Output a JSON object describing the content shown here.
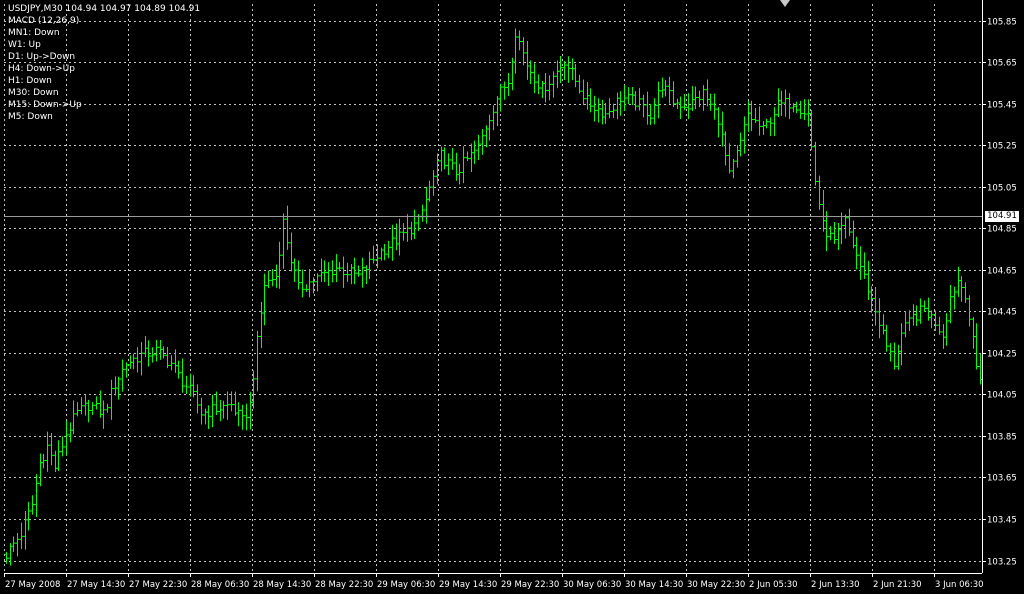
{
  "header": {
    "symbol_line": "USDJPY,M30  104.94 104.97 104.89 104.91",
    "indicator": "MACD (12,26,9)",
    "trend_lines": [
      "MN1: Down",
      "W1: Up",
      "D1: Up->Down",
      "H4: Down->Up",
      "H1: Down",
      "M30: Down",
      "M15: Down->Up",
      "M5: Down"
    ]
  },
  "colors": {
    "background": "#000000",
    "bars": "#00ff00",
    "grid": "#c0c0c0",
    "text": "#ffffff"
  },
  "current_price": "104.91",
  "chart_data": {
    "type": "ohlc_bar",
    "symbol": "USDJPY",
    "timeframe": "M30",
    "grid": true,
    "ylim": [
      103.19,
      105.93
    ],
    "y_ticks": [
      "105.85",
      "105.65",
      "105.45",
      "105.25",
      "105.05",
      "104.85",
      "104.65",
      "104.45",
      "104.25",
      "104.05",
      "103.85",
      "103.65",
      "103.45",
      "103.25"
    ],
    "x_ticks": [
      "27 May 2008",
      "27 May 14:30",
      "27 May 22:30",
      "28 May 06:30",
      "28 May 14:30",
      "28 May 22:30",
      "29 May 06:30",
      "29 May 14:30",
      "29 May 22:30",
      "30 May 06:30",
      "30 May 14:30",
      "30 May 22:30",
      "2 Jun 05:30",
      "2 Jun 13:30",
      "2 Jun 21:30",
      "3 Jun 06:30"
    ],
    "current_price": 104.91,
    "close_path": [
      [
        0,
        103.28
      ],
      [
        4,
        103.38
      ],
      [
        7,
        103.52
      ],
      [
        9,
        103.72
      ],
      [
        11,
        103.8
      ],
      [
        13,
        103.7
      ],
      [
        16,
        103.86
      ],
      [
        19,
        103.96
      ],
      [
        22,
        104.0
      ],
      [
        26,
        103.96
      ],
      [
        29,
        104.1
      ],
      [
        32,
        104.2
      ],
      [
        36,
        104.24
      ],
      [
        40,
        104.26
      ],
      [
        44,
        104.2
      ],
      [
        46,
        104.14
      ],
      [
        50,
        104.04
      ],
      [
        52,
        103.96
      ],
      [
        56,
        103.98
      ],
      [
        60,
        104.0
      ],
      [
        63,
        103.92
      ],
      [
        65,
        104.0
      ],
      [
        67,
        104.3
      ],
      [
        69,
        104.58
      ],
      [
        72,
        104.62
      ],
      [
        74,
        104.88
      ],
      [
        76,
        104.7
      ],
      [
        78,
        104.56
      ],
      [
        82,
        104.6
      ],
      [
        88,
        104.66
      ],
      [
        94,
        104.62
      ],
      [
        100,
        104.74
      ],
      [
        106,
        104.82
      ],
      [
        110,
        104.88
      ],
      [
        113,
        105.04
      ],
      [
        116,
        105.2
      ],
      [
        120,
        105.12
      ],
      [
        123,
        105.18
      ],
      [
        126,
        105.24
      ],
      [
        128,
        105.34
      ],
      [
        131,
        105.48
      ],
      [
        134,
        105.56
      ],
      [
        136,
        105.8
      ],
      [
        139,
        105.64
      ],
      [
        143,
        105.52
      ],
      [
        146,
        105.58
      ],
      [
        149,
        105.66
      ],
      [
        152,
        105.56
      ],
      [
        155,
        105.46
      ],
      [
        160,
        105.4
      ],
      [
        164,
        105.48
      ],
      [
        168,
        105.46
      ],
      [
        172,
        105.4
      ],
      [
        175,
        105.54
      ],
      [
        178,
        105.46
      ],
      [
        182,
        105.44
      ],
      [
        186,
        105.5
      ],
      [
        190,
        105.38
      ],
      [
        193,
        105.1
      ],
      [
        196,
        105.26
      ],
      [
        198,
        105.4
      ],
      [
        202,
        105.32
      ],
      [
        206,
        105.44
      ],
      [
        210,
        105.46
      ],
      [
        214,
        105.4
      ],
      [
        216,
        105.08
      ],
      [
        218,
        104.86
      ],
      [
        221,
        104.78
      ],
      [
        224,
        104.88
      ],
      [
        227,
        104.72
      ],
      [
        230,
        104.56
      ],
      [
        233,
        104.4
      ],
      [
        235,
        104.28
      ],
      [
        237,
        104.2
      ],
      [
        239,
        104.34
      ],
      [
        242,
        104.42
      ],
      [
        245,
        104.46
      ],
      [
        248,
        104.4
      ],
      [
        250,
        104.34
      ],
      [
        252,
        104.52
      ],
      [
        254,
        104.6
      ],
      [
        256,
        104.54
      ],
      [
        258,
        104.3
      ],
      [
        259,
        104.18
      ],
      [
        260,
        104.14
      ]
    ]
  }
}
